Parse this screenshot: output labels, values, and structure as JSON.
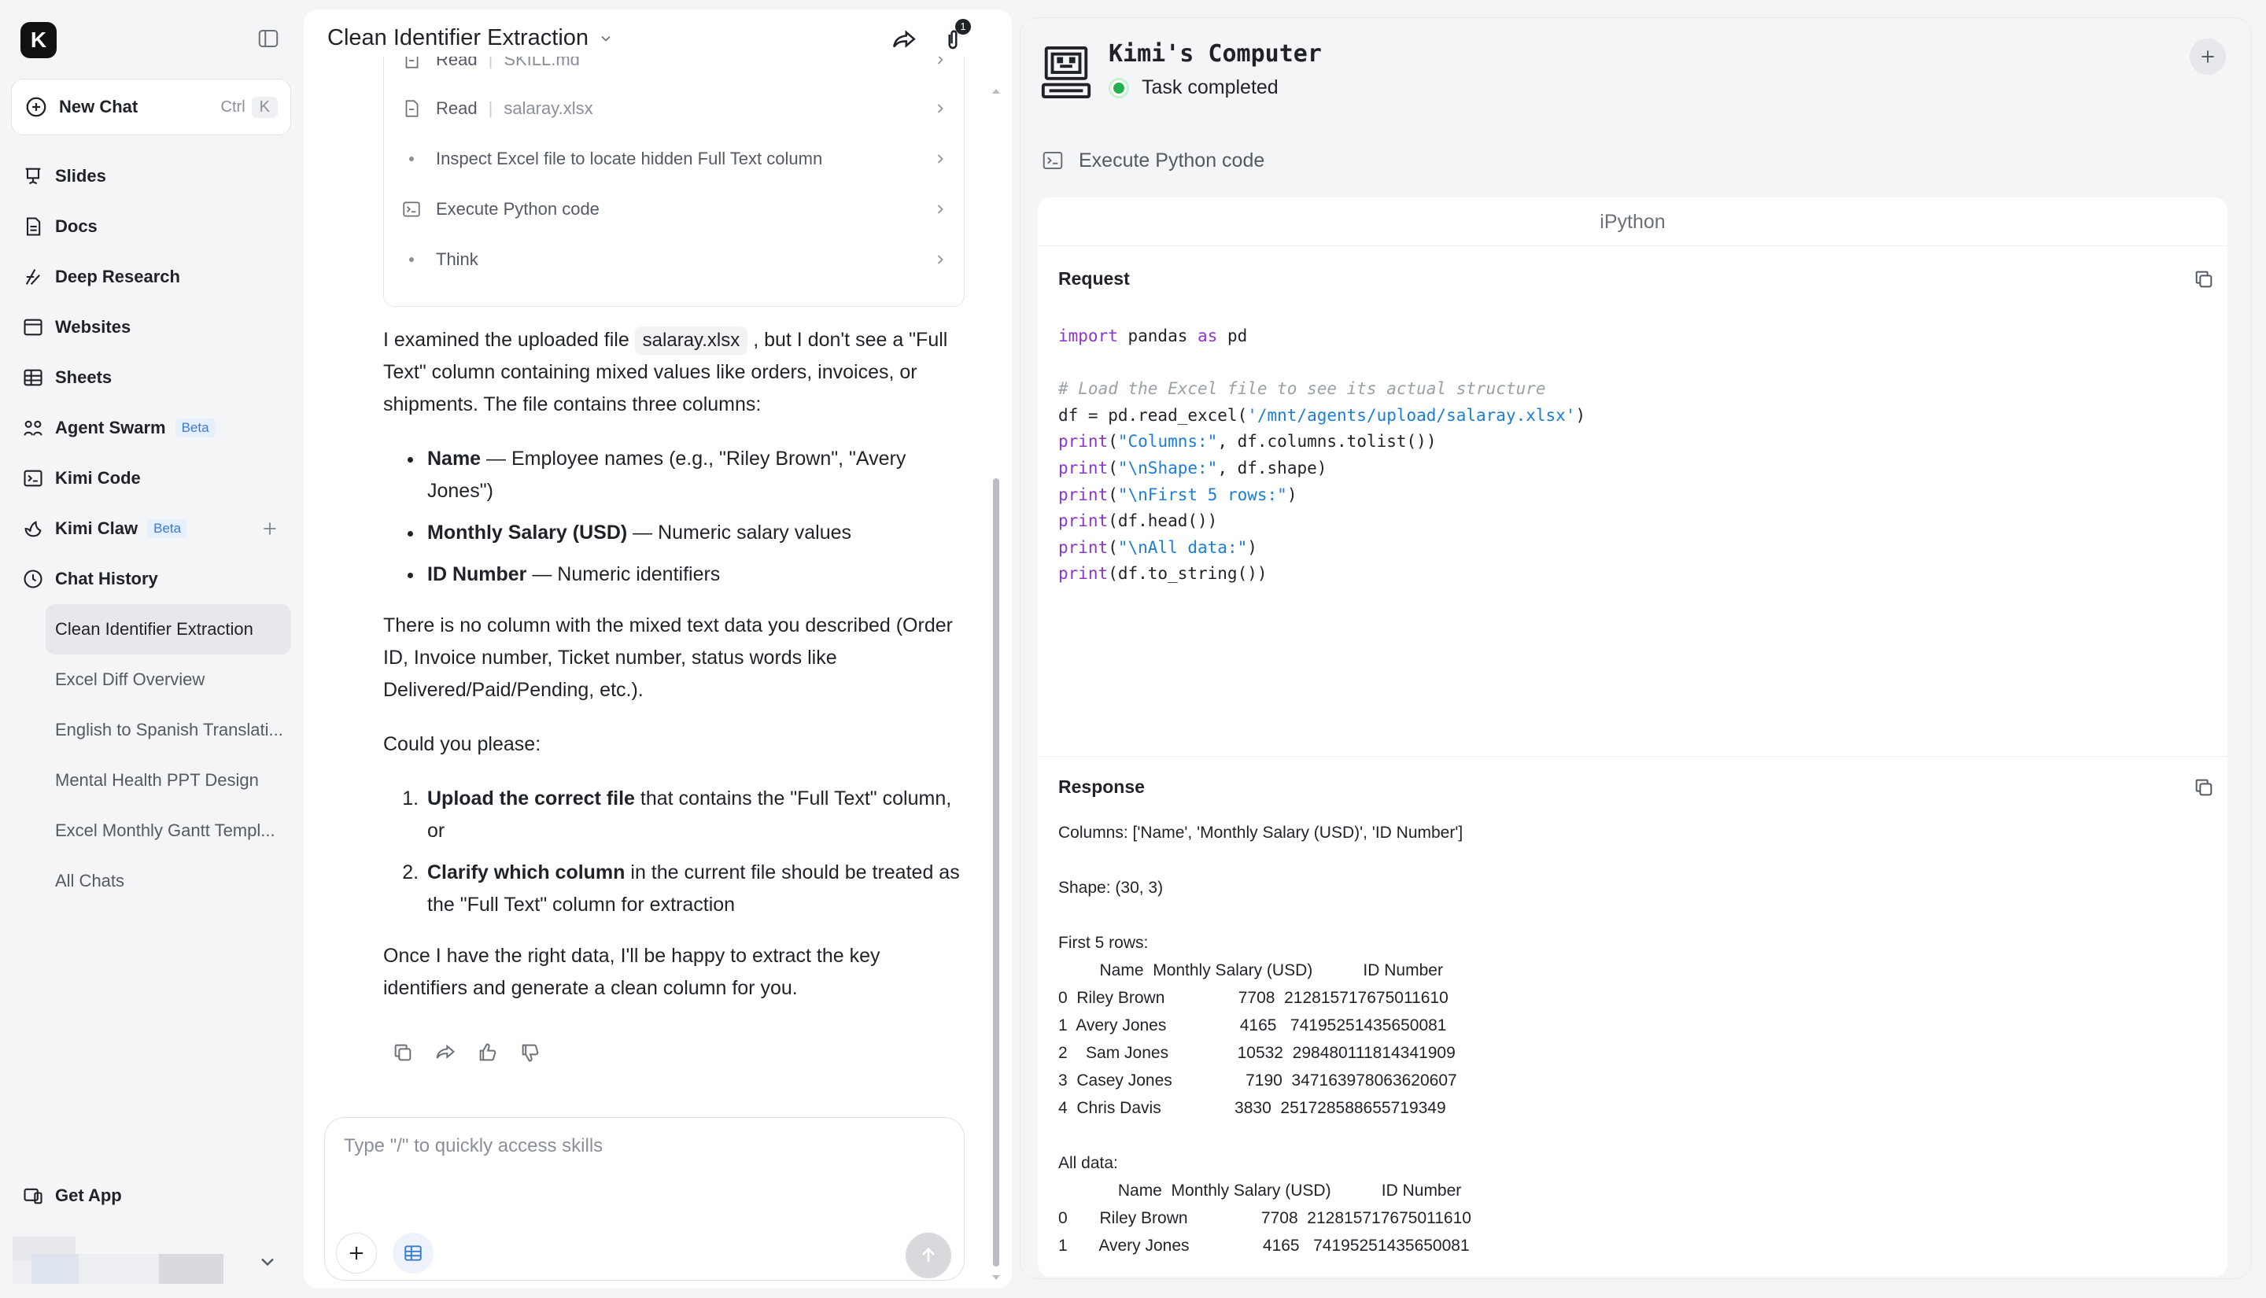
{
  "sidebar": {
    "logo": "K",
    "new_chat": {
      "label": "New Chat",
      "shortcut_mod": "Ctrl",
      "shortcut_key": "K"
    },
    "nav": [
      {
        "label": "Slides",
        "icon": "slides-icon"
      },
      {
        "label": "Docs",
        "icon": "docs-icon"
      },
      {
        "label": "Deep Research",
        "icon": "deep-research-icon"
      },
      {
        "label": "Websites",
        "icon": "websites-icon"
      },
      {
        "label": "Sheets",
        "icon": "sheets-icon"
      },
      {
        "label": "Agent Swarm",
        "icon": "agent-swarm-icon",
        "badge": "Beta"
      },
      {
        "label": "Kimi Code",
        "icon": "terminal-icon"
      },
      {
        "label": "Kimi Claw",
        "icon": "claw-icon",
        "badge": "Beta"
      },
      {
        "label": "Chat History",
        "icon": "clock-icon"
      }
    ],
    "history": [
      "Clean Identifier Extraction",
      "Excel Diff Overview",
      "English to Spanish Translati...",
      "Mental Health PPT Design",
      "Excel Monthly Gantt Templ...",
      "All Chats"
    ],
    "get_app": "Get App"
  },
  "chat": {
    "title": "Clean Identifier Extraction",
    "attachment_count": "1",
    "steps": [
      {
        "label": "Read",
        "file": "SKILL.md",
        "icon": "file-icon"
      },
      {
        "label": "Read",
        "file": "salaray.xlsx",
        "icon": "file-icon"
      },
      {
        "label": "Inspect Excel file to locate hidden Full Text column",
        "icon": "dot"
      },
      {
        "label": "Execute Python code",
        "icon": "terminal-icon"
      },
      {
        "label": "Think",
        "icon": "dot"
      }
    ],
    "message": {
      "p1_a": "I examined the uploaded file ",
      "p1_chip": "salaray.xlsx",
      "p1_b": " , but I don't see a \"Full Text\" column containing mixed values like orders, invoices, or shipments. The file contains three columns:",
      "bullets": [
        {
          "bold": "Name",
          "text": " — Employee names (e.g., \"Riley Brown\", \"Avery Jones\")"
        },
        {
          "bold": "Monthly Salary (USD)",
          "text": " — Numeric salary values"
        },
        {
          "bold": "ID Number",
          "text": " — Numeric identifiers"
        }
      ],
      "p2": "There is no column with the mixed text data you described (Order ID, Invoice number, Ticket number, status words like Delivered/Paid/Pending, etc.).",
      "p3": "Could you please:",
      "numbered": [
        {
          "bold": "Upload the correct file",
          "text": " that contains the \"Full Text\" column, or"
        },
        {
          "bold": "Clarify which column",
          "text": " in the current file should be treated as the \"Full Text\" column for extraction"
        }
      ],
      "p4": "Once I have the right data, I'll be happy to extract the key identifiers and generate a clean column for you."
    },
    "composer_placeholder": "Type \"/\" to quickly access skills"
  },
  "computer": {
    "title": "Kimi's Computer",
    "status": "Task completed",
    "tool_label": "Execute Python code",
    "panel_title": "iPython",
    "request_label": "Request",
    "response_label": "Response",
    "code_lines": [
      "import pandas as pd",
      "",
      "# Load the Excel file to see its actual structure",
      "df = pd.read_excel('/mnt/agents/upload/salaray.xlsx')",
      "print(\"Columns:\", df.columns.tolist())",
      "print(\"\\nShape:\", df.shape)",
      "print(\"\\nFirst 5 rows:\")",
      "print(df.head())",
      "print(\"\\nAll data:\")",
      "print(df.to_string())"
    ],
    "output_lines": [
      "Columns: ['Name', 'Monthly Salary (USD)', 'ID Number']",
      "",
      "Shape: (30, 3)",
      "",
      "First 5 rows:",
      "         Name  Monthly Salary (USD)           ID Number",
      "0  Riley Brown                7708  212815717675011610",
      "1  Avery Jones                4165   74195251435650081",
      "2    Sam Jones               10532  298480111814341909",
      "3  Casey Jones                7190  347163978063620607",
      "4  Chris Davis                3830  251728588655719349",
      "",
      "All data:",
      "             Name  Monthly Salary (USD)           ID Number",
      "0       Riley Brown                7708  212815717675011610",
      "1       Avery Jones                4165   74195251435650081"
    ]
  },
  "colors": {
    "accent_blue": "#3a7bd5",
    "status_green": "#22b14c",
    "keyword_purple": "#8c35c9",
    "string_blue": "#1c7ed6"
  }
}
